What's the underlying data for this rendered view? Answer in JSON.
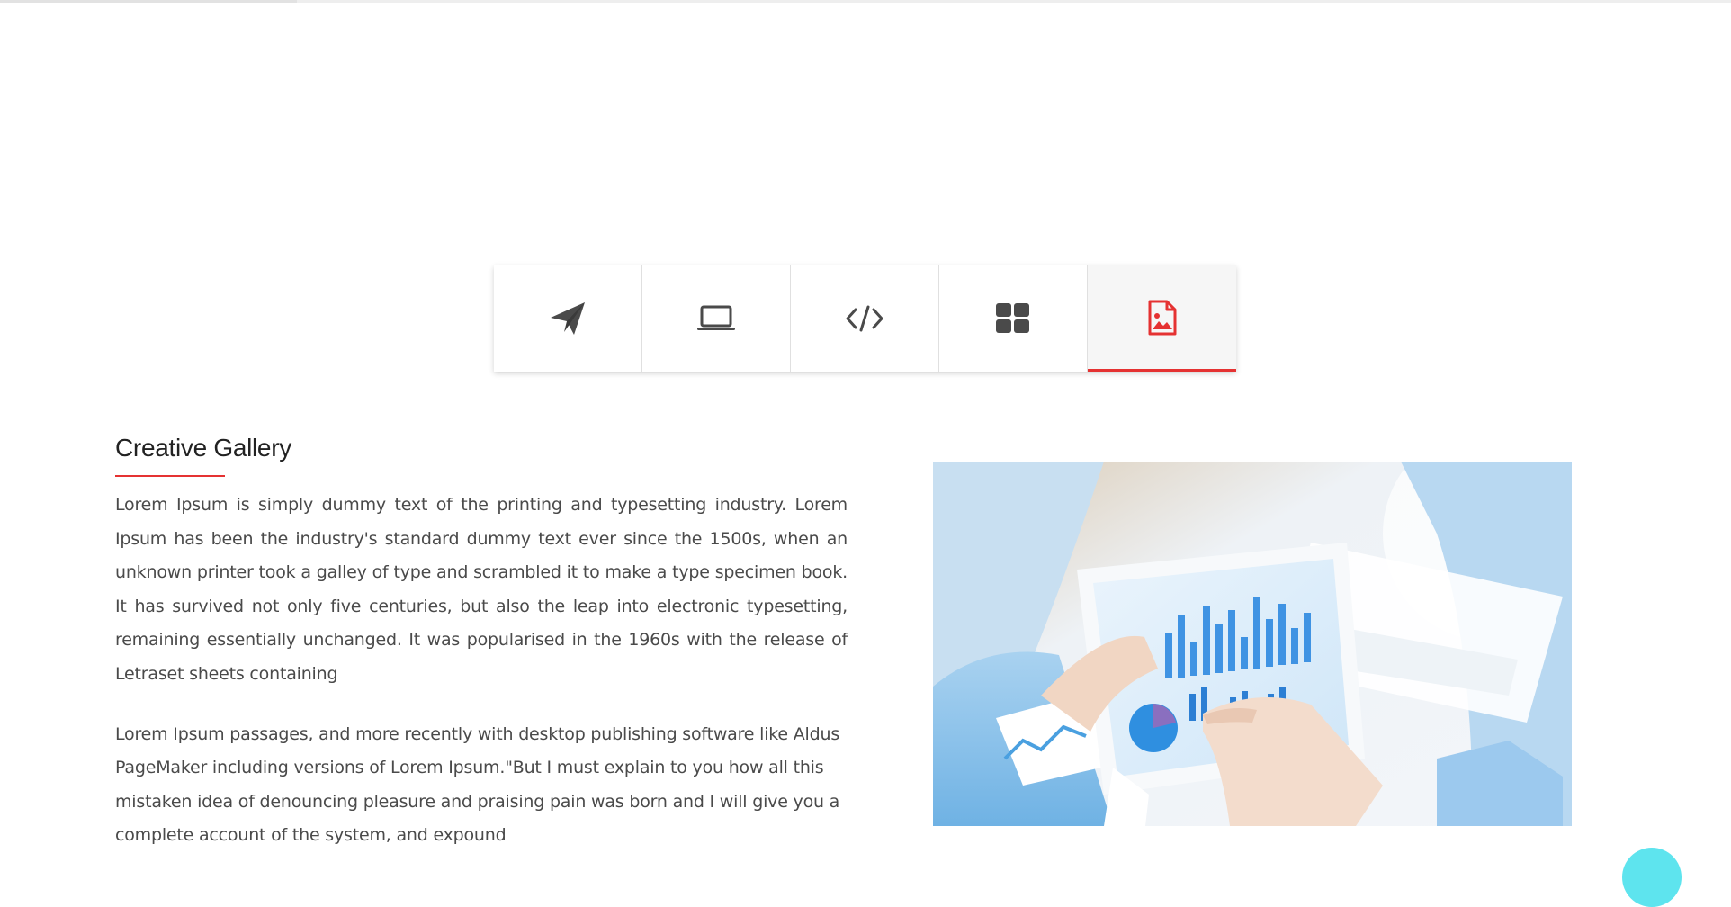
{
  "tabs": [
    {
      "icon": "paper-plane-icon",
      "active": false
    },
    {
      "icon": "laptop-icon",
      "active": false
    },
    {
      "icon": "code-icon",
      "active": false
    },
    {
      "icon": "grid-icon",
      "active": false
    },
    {
      "icon": "image-file-icon",
      "active": true
    }
  ],
  "section": {
    "title": "Creative Gallery",
    "paragraph_1": "Lorem Ipsum is simply dummy text of the printing and typesetting industry. Lorem Ipsum has been the industry's standard dummy text ever since the 1500s, when an unknown printer took a galley of type and scrambled it to make a type specimen book. It has survived not only five centuries, but also the leap into electronic typesetting, remaining essentially unchanged. It was popularised in the 1960s with the release of Letraset sheets containing",
    "paragraph_2": "Lorem Ipsum passages, and more recently with desktop publishing software like Aldus PageMaker including versions of Lorem Ipsum.\"But I must explain to you how all this mistaken idea of denouncing pleasure and praising pain was born and I will give you a complete account of the system, and expound"
  },
  "image": {
    "subject": "hands holding a tablet showing blue charts"
  },
  "colors": {
    "accent": "#e53232",
    "icon": "#4a4a4a",
    "text": "#4a4a4a",
    "heading": "#222222",
    "scroll_button": "#5ee4ee"
  }
}
